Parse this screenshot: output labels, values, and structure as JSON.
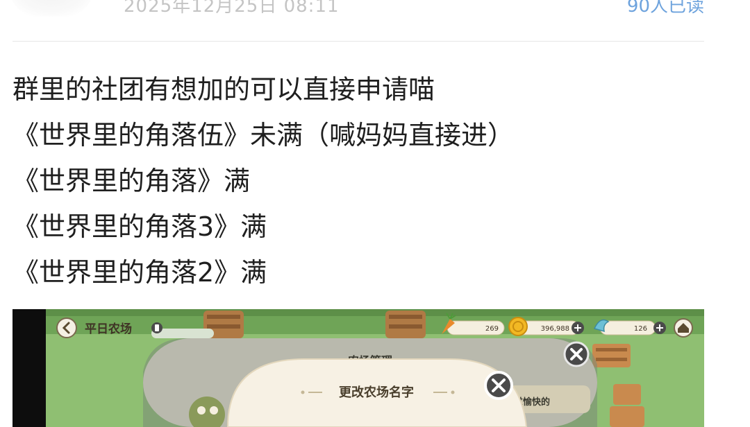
{
  "post": {
    "date": "2025年12月25日 08:11",
    "reads": "90人已读",
    "lines": [
      "群里的社团有想加的可以直接申请喵",
      "《世界里的角落伍》未满（喊妈妈直接进）",
      "《世界里的角落》满",
      "《世界里的角落3》满",
      "《世界里的角落2》满"
    ]
  },
  "game_screenshot": {
    "farm_title": "平日农场",
    "carrot_count": "269",
    "coin_count": "396,988",
    "gem_count": "126",
    "panel_title": "农场管理",
    "dialog_title": "更改农场名字",
    "side_text": "过愉快的",
    "icons": [
      "back-icon",
      "info-icon",
      "carrot-icon",
      "coin-icon",
      "plus-icon",
      "bird-icon",
      "home-icon",
      "close-icon"
    ]
  }
}
